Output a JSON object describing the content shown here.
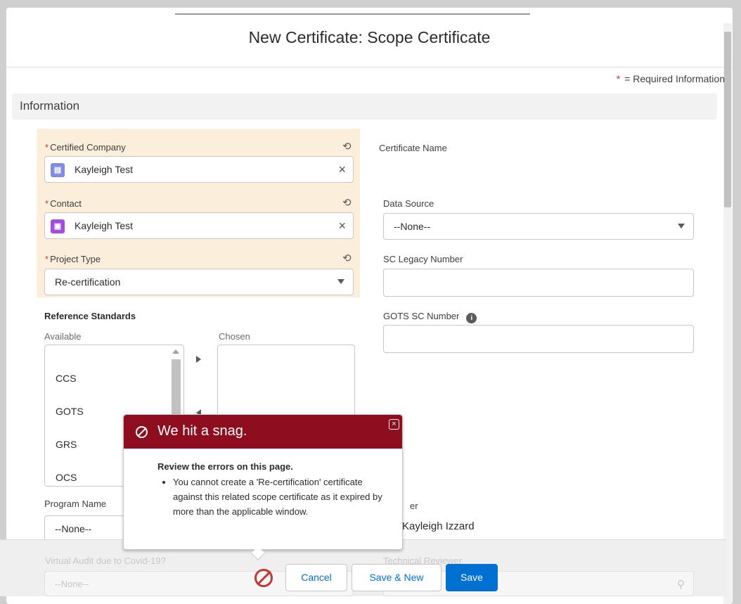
{
  "modal": {
    "title": "New Certificate: Scope Certificate",
    "required_star": "*",
    "required_note": "= Required Information",
    "section_title": "Information"
  },
  "left": {
    "certified_company": {
      "label": "Certified Company",
      "value": "Kayleigh Test",
      "icon": "account-icon"
    },
    "contact": {
      "label": "Contact",
      "value": "Kayleigh Test",
      "icon": "contact-icon"
    },
    "project_type": {
      "label": "Project Type",
      "value": "Re-certification"
    },
    "reference_standards": {
      "title": "Reference Standards",
      "available_label": "Available",
      "chosen_label": "Chosen",
      "available": [
        "CCS",
        "GOTS",
        "GRS",
        "OCS"
      ],
      "chosen": []
    },
    "program_name": {
      "label": "Program Name",
      "value": "--None--"
    },
    "virtual_audit": {
      "label": "Virtual Audit due to Covid-19?",
      "value": "--None--"
    }
  },
  "right": {
    "certificate_name": {
      "label": "Certificate Name"
    },
    "data_source": {
      "label": "Data Source",
      "value": "--None--"
    },
    "sc_legacy_number": {
      "label": "SC Legacy Number",
      "value": ""
    },
    "gots_sc_number": {
      "label": "GOTS SC Number",
      "value": ""
    },
    "owner": {
      "label_fragment": "er",
      "value": "Kayleigh Izzard"
    },
    "technical_reviewer": {
      "label": "Technical Reviewer"
    }
  },
  "error": {
    "title": "We hit a snag.",
    "heading": "Review the errors on this page.",
    "messages": [
      "You cannot create a 'Re-certification' certificate against this related scope certificate as it expired by more than the applicable window."
    ]
  },
  "footer": {
    "cancel": "Cancel",
    "save_new": "Save & New",
    "save": "Save"
  },
  "colors": {
    "brand": "#0070d2",
    "error_header": "#8e0d1e",
    "changed_field_bg": "#fbeedb",
    "required": "#c23934"
  }
}
